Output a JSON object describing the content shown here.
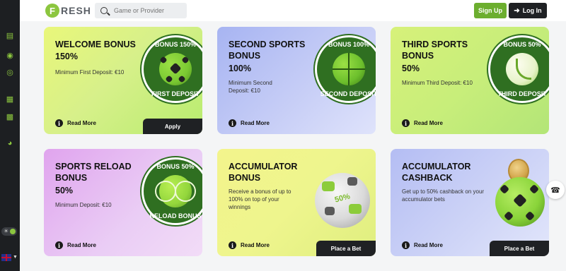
{
  "header": {
    "logo_letter": "F",
    "logo_text": "RESH",
    "search_placeholder": "Game or Provider",
    "signup_label": "Sign Up",
    "login_label": "Log In"
  },
  "colors": {
    "brand_green": "#6cae2f",
    "dark": "#1f2124",
    "sidebar": "#1d1f22"
  },
  "sidebar": {
    "icons": [
      "cards-icon",
      "money-bag-icon",
      "ball-icon",
      "gift-icon",
      "calendar-icon",
      "gauge-icon"
    ]
  },
  "cards": [
    {
      "title_line1": "WELCOME BONUS",
      "title_line2": "",
      "percent": "150%",
      "description": "Minimum First Deposit: €10",
      "read_more": "Read More",
      "action": "Apply",
      "badge_top": "BONUS 150%",
      "badge_bottom": "FIRST DEPOSIT"
    },
    {
      "title_line1": "SECOND SPORTS",
      "title_line2": "BONUS",
      "percent": "100%",
      "description": "Minimum Second Deposit: €10",
      "read_more": "Read More",
      "badge_top": "BONUS 100%",
      "badge_bottom": "SECOND DEPOSIT"
    },
    {
      "title_line1": "THIRD SPORTS",
      "title_line2": "BONUS",
      "percent": "50%",
      "description": "Minimum Third Deposit: €10",
      "read_more": "Read More",
      "badge_top": "BONUS 50%",
      "badge_bottom": "THIRD DEPOSIT"
    },
    {
      "title_line1": "SPORTS RELOAD",
      "title_line2": "BONUS",
      "percent": "50%",
      "description": "Minimum Deposit: €10",
      "read_more": "Read More",
      "badge_top": "BONUS 50%",
      "badge_bottom": "RELOAD BONUS"
    },
    {
      "title_line1": "ACCUMULATOR",
      "title_line2": "BONUS",
      "description": "Receive a bonus of up to 100% on top of your winnings",
      "read_more": "Read More",
      "action": "Place a Bet",
      "art_tag": "50%"
    },
    {
      "title_line1": "ACCUMULATOR",
      "title_line2": "CASHBACK",
      "description": "Get up to 50% cashback on your accumulator bets",
      "read_more": "Read More",
      "action": "Place a Bet"
    }
  ]
}
